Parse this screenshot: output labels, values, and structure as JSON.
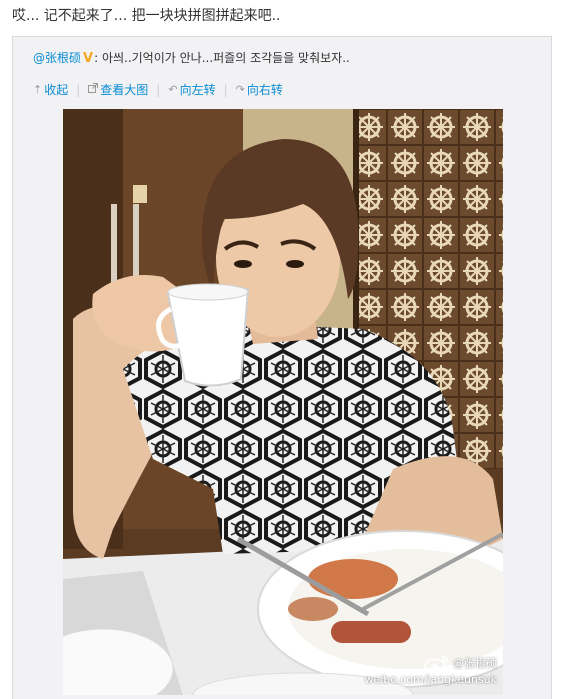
{
  "post": {
    "text": "哎... 记不起来了... 把一块块拼图拼起来吧.."
  },
  "repost": {
    "author": "@张根硕",
    "colon": ": ",
    "text": "아씌..기억이가 안나...퍼즐의 조각들을 맞춰보자.."
  },
  "toolbar": {
    "collapse_label": "收起",
    "view_large_label": "查看大图",
    "rotate_left_label": "向左转",
    "rotate_right_label": "向右转"
  },
  "icons": {
    "collapse": "arrow-up-icon",
    "view_large": "external-link-icon",
    "rotate_left": "rotate-left-icon",
    "rotate_right": "rotate-right-icon",
    "verified": "verified-v-icon",
    "weibo": "weibo-logo-icon"
  },
  "watermark": {
    "name": "@张根硕",
    "url": "weibo.com/jangkeunsuk"
  },
  "colors": {
    "link": "#0a8cd2",
    "verified_badge": "#f5a623",
    "repost_bg": "#f2f2f5"
  }
}
